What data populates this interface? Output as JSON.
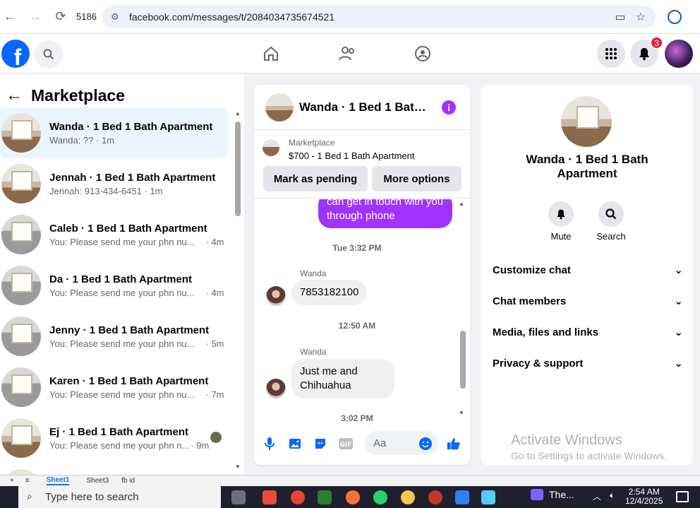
{
  "browser": {
    "tab_count": "5186",
    "url": "facebook.com/messages/t/2084034735674521"
  },
  "fb_header": {
    "notification_count": "3"
  },
  "left_panel": {
    "title": "Marketplace",
    "conversations": [
      {
        "name": "Wanda · 1 Bed 1 Bath Apartment",
        "snippet": "Wanda: ?? · 1m",
        "time": "",
        "active": true
      },
      {
        "name": "Jennah · 1 Bed 1 Bath Apartment",
        "snippet": "Jennah: 913-434-6451 · 1m",
        "time": ""
      },
      {
        "name": "Caleb · 1 Bed 1 Bath Apartment",
        "snippet": "You: Please send me your phn nu...",
        "time": "· 4m"
      },
      {
        "name": "Da · 1 Bed 1 Bath Apartment",
        "snippet": "You: Please send me your phn nu...",
        "time": "· 4m"
      },
      {
        "name": "Jenny · 1 Bed 1 Bath Apartment",
        "snippet": "You: Please send me your phn nu...",
        "time": "· 5m"
      },
      {
        "name": "Karen · 1 Bed 1 Bath Apartment",
        "snippet": "You: Please send me your phn nu...",
        "time": "· 7m"
      },
      {
        "name": "Ej · 1 Bed 1 Bath Apartment",
        "snippet": "You: Please send me your phn n...",
        "time": "· 9m"
      }
    ]
  },
  "chat": {
    "title": "Wanda · 1 Bed 1 Bath ...",
    "listing_tag": "Marketplace",
    "listing_price": "$700 - 1 Bed 1 Bath Apartment",
    "mark_pending": "Mark as pending",
    "more_options": "More options",
    "outgoing_partial": "can get in touch with you through phone",
    "ts1": "Tue 3:32 PM",
    "sender1": "Wanda",
    "msg1": "7853182100",
    "ts2": "12:50 AM",
    "sender2": "Wanda",
    "msg2": "Just me and Chihuahua",
    "ts3": "3:02 PM",
    "input_placeholder": "Aa"
  },
  "right_panel": {
    "name": "Wanda · 1 Bed 1 Bath Apartment",
    "mute_label": "Mute",
    "search_label": "Search",
    "rows": [
      "Customize chat",
      "Chat members",
      "Media, files and links",
      "Privacy & support"
    ],
    "activate_title": "Activate Windows",
    "activate_sub": "Go to Settings to activate Windows."
  },
  "sheets": {
    "tabs": [
      "Sheet1",
      "Sheet3",
      "fb id"
    ]
  },
  "taskbar": {
    "search_placeholder": "Type here to search",
    "app_label": "The...",
    "time": "2:54 AM",
    "date": "12/4/2025"
  },
  "colors": {
    "fb_blue": "#0866ff",
    "messenger_purple": "#a033ff",
    "badge_red": "#e41e3f"
  }
}
